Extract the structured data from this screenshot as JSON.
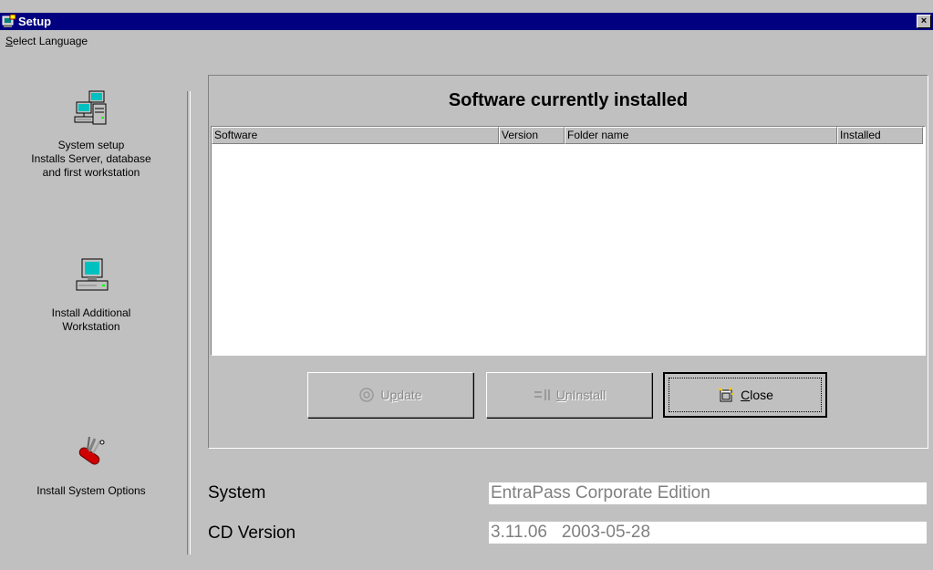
{
  "window": {
    "title": "Setup",
    "close_label": "×"
  },
  "menu": {
    "select_language": {
      "mnemonic": "S",
      "rest": "elect Language"
    }
  },
  "nav": {
    "system_setup": {
      "icon": "network-computers-icon",
      "line1": "System setup",
      "line2": "Installs Server, database",
      "line3": "and first workstation"
    },
    "additional_workstation": {
      "icon": "computer-icon",
      "line1": "Install Additional",
      "line2": "Workstation"
    },
    "system_options": {
      "icon": "tools-icon",
      "line1": "Install System Options"
    }
  },
  "panel": {
    "title": "Software currently installed",
    "columns": [
      "Software",
      "Version",
      "Folder name",
      "Installed"
    ],
    "rows": []
  },
  "buttons": {
    "update": {
      "pre": "U",
      "mnemonic": "p",
      "post": "date",
      "enabled": false,
      "icon": "update-icon"
    },
    "uninstall": {
      "pre": "",
      "mnemonic": "U",
      "post": "nInstall",
      "enabled": false,
      "icon": "uninstall-icon"
    },
    "close": {
      "pre": "",
      "mnemonic": "C",
      "post": "lose",
      "enabled": true,
      "icon": "close-door-icon"
    }
  },
  "info": {
    "system_label": "System",
    "system_value": "EntraPass Corporate Edition",
    "cd_version_label": "CD Version",
    "cd_version_value": "3.11.06   2003-05-28"
  },
  "colors": {
    "titlebar": "#000080",
    "face": "#c0c0c0",
    "disabled_text": "#808080"
  }
}
